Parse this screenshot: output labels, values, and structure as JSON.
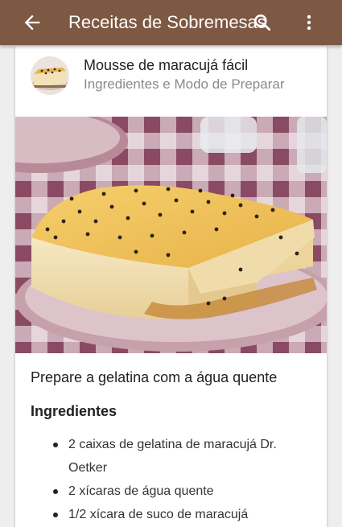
{
  "appbar": {
    "title": "Receitas de Sobremesas",
    "bg_color": "#7d5842",
    "icons": [
      "back-arrow-icon",
      "search-icon",
      "more-vert-icon"
    ]
  },
  "recipe": {
    "name": "Mousse de maracujá fácil",
    "subtitle": "Ingredientes e Modo de Preparar",
    "step": "Prepare a gelatina com a água quente",
    "ingredients_title": "Ingredientes",
    "ingredients": [
      "2 caixas de gelatina de maracujá Dr. Oetker",
      "2 xícaras de água quente",
      "1/2 xícara de suco de maracujá"
    ]
  }
}
